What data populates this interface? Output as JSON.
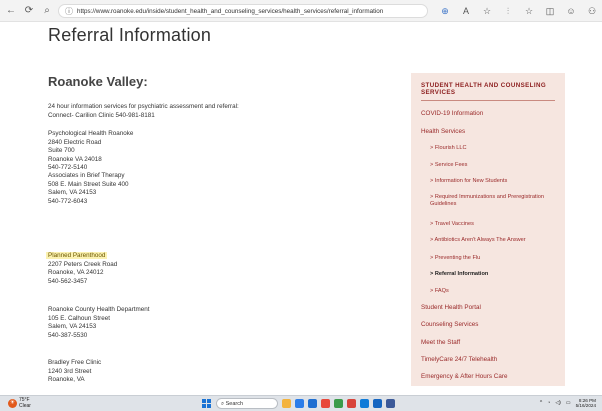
{
  "browser": {
    "url": "https://www.roanoke.edu/inside/student_health_and_counseling_services/health_services/referral_information",
    "nav": {
      "back": "←",
      "refresh": "⟳",
      "search": "⌕"
    },
    "toolbar": [
      "⊕",
      "A",
      "☆",
      "⫶",
      "☆",
      "◫",
      "☺",
      "⚇"
    ]
  },
  "page": {
    "title": "Referral Information",
    "section": "Roanoke Valley:",
    "intro": [
      "24 hour information services for psychiatric assessment and referral:",
      "Connect- Carilion Clinic 540-981-8181"
    ],
    "entries": [
      {
        "lines": [
          "Psychological Health Roanoke",
          "2840 Electric Road",
          "Suite 700",
          "Roanoke VA 24018",
          "540-772-5140"
        ]
      },
      {
        "lines": [
          "Associates in Brief Therapy",
          "508 E. Main Street Suite 400",
          "Salem, VA 24153",
          "540-772-6043"
        ]
      },
      {
        "lines": [
          "Planned Parenthood",
          "2207 Peters Creek Road",
          "Roanoke, VA 24012",
          "540-562-3457"
        ],
        "highlight_first": true
      },
      {
        "lines": [
          "Roanoke County Health Department",
          "105 E. Calhoun Street",
          "Salem, VA 24153",
          "540-387-5530"
        ]
      },
      {
        "lines": [
          "Bradley Free Clinic",
          "1240 3rd Street",
          "Roanoke, VA"
        ]
      }
    ]
  },
  "sidebar": {
    "heading": "STUDENT HEALTH AND COUNSELING SERVICES",
    "links": [
      {
        "label": "COVID-19 Information",
        "level": 0
      },
      {
        "label": "Health Services",
        "level": 0
      },
      {
        "label": "> Flourish LLC",
        "level": 1
      },
      {
        "label": "> Service Fees",
        "level": 1
      },
      {
        "label": "> Information for New Students",
        "level": 1
      },
      {
        "label": "> Required Immunizations and Preregistration Guidelines",
        "level": 1
      },
      {
        "label": "> Travel Vaccines",
        "level": 1
      },
      {
        "label": "> Antibiotics Aren't Always The Answer",
        "level": 1
      },
      {
        "label": "> Preventing the Flu",
        "level": 1
      },
      {
        "label": "> Referral Information",
        "level": 1,
        "active": true
      },
      {
        "label": "> FAQs",
        "level": 1
      },
      {
        "label": "Student Health Portal",
        "level": 0
      },
      {
        "label": "Counseling Services",
        "level": 0
      },
      {
        "label": "Meet the Staff",
        "level": 0
      },
      {
        "label": "TimelyCare 24/7 Telehealth",
        "level": 0
      },
      {
        "label": "Emergency & After Hours Care",
        "level": 0
      }
    ]
  },
  "taskbar": {
    "weather_temp": "75°F",
    "weather_desc": "Clear",
    "search_label": "Search",
    "time": "8:26 PM",
    "date": "5/16/2024",
    "app_colors": [
      "#f3b33d",
      "#2b7de9",
      "#1f6fd1",
      "#e8493b",
      "#3b9c4a",
      "#d8443a",
      "#0f7bd8",
      "#1565c0",
      "#3c5a99"
    ]
  }
}
